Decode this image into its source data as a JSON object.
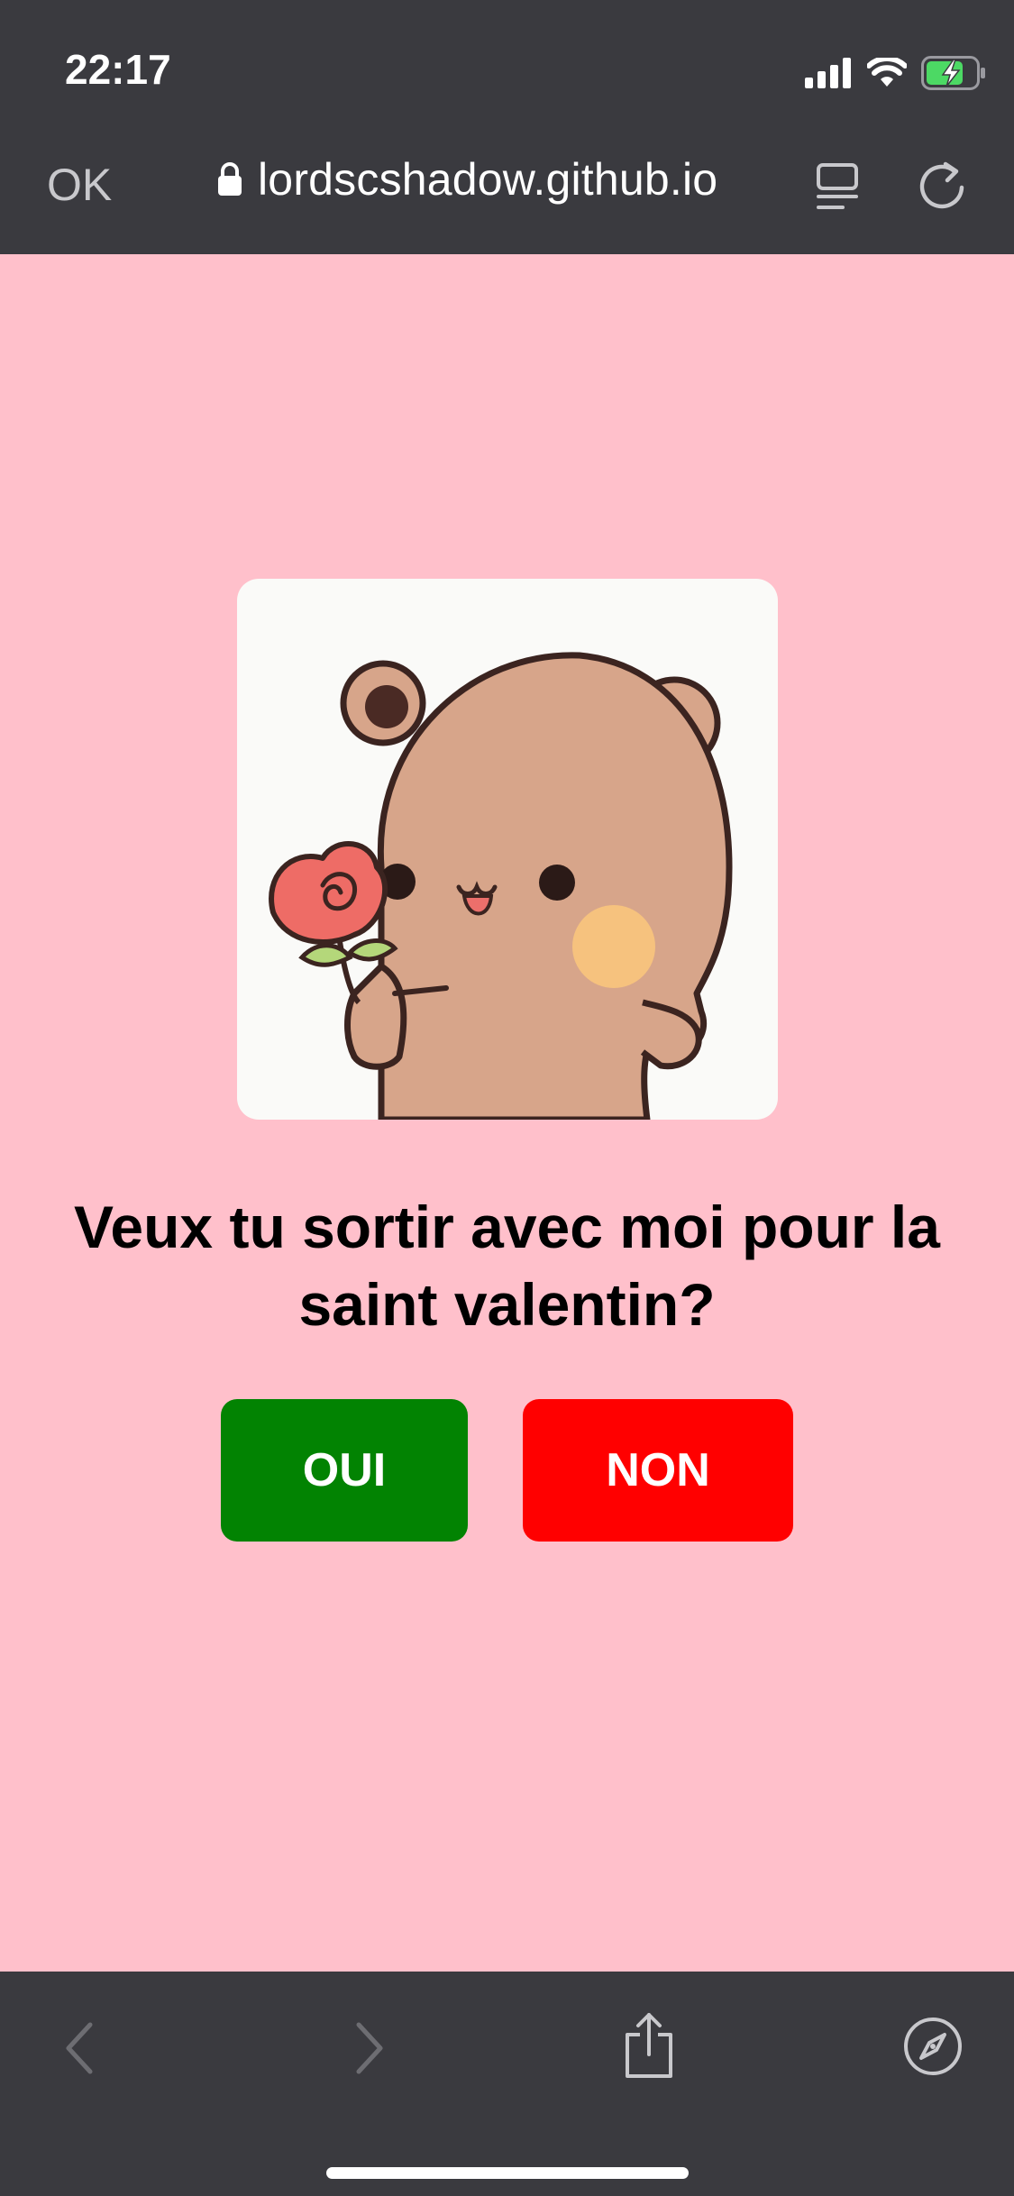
{
  "status_bar": {
    "time": "22:17",
    "icons": [
      "signal-icon",
      "wifi-icon",
      "battery-charging-icon"
    ],
    "battery_color": "#4cd964"
  },
  "browser": {
    "done_label": "OK",
    "url": "lordscshadow.github.io",
    "icons": [
      "lock-icon",
      "reader-mode-icon",
      "reload-icon"
    ]
  },
  "page": {
    "background": "#ffc0cb",
    "image": "bear-holding-rose",
    "question": "Veux tu sortir avec moi pour la saint valentin?",
    "yes_label": "OUI",
    "no_label": "NON",
    "yes_color": "#028302",
    "no_color": "#ff0000"
  },
  "toolbar": {
    "icons": [
      "back-icon",
      "forward-icon",
      "share-icon",
      "compass-icon"
    ]
  }
}
